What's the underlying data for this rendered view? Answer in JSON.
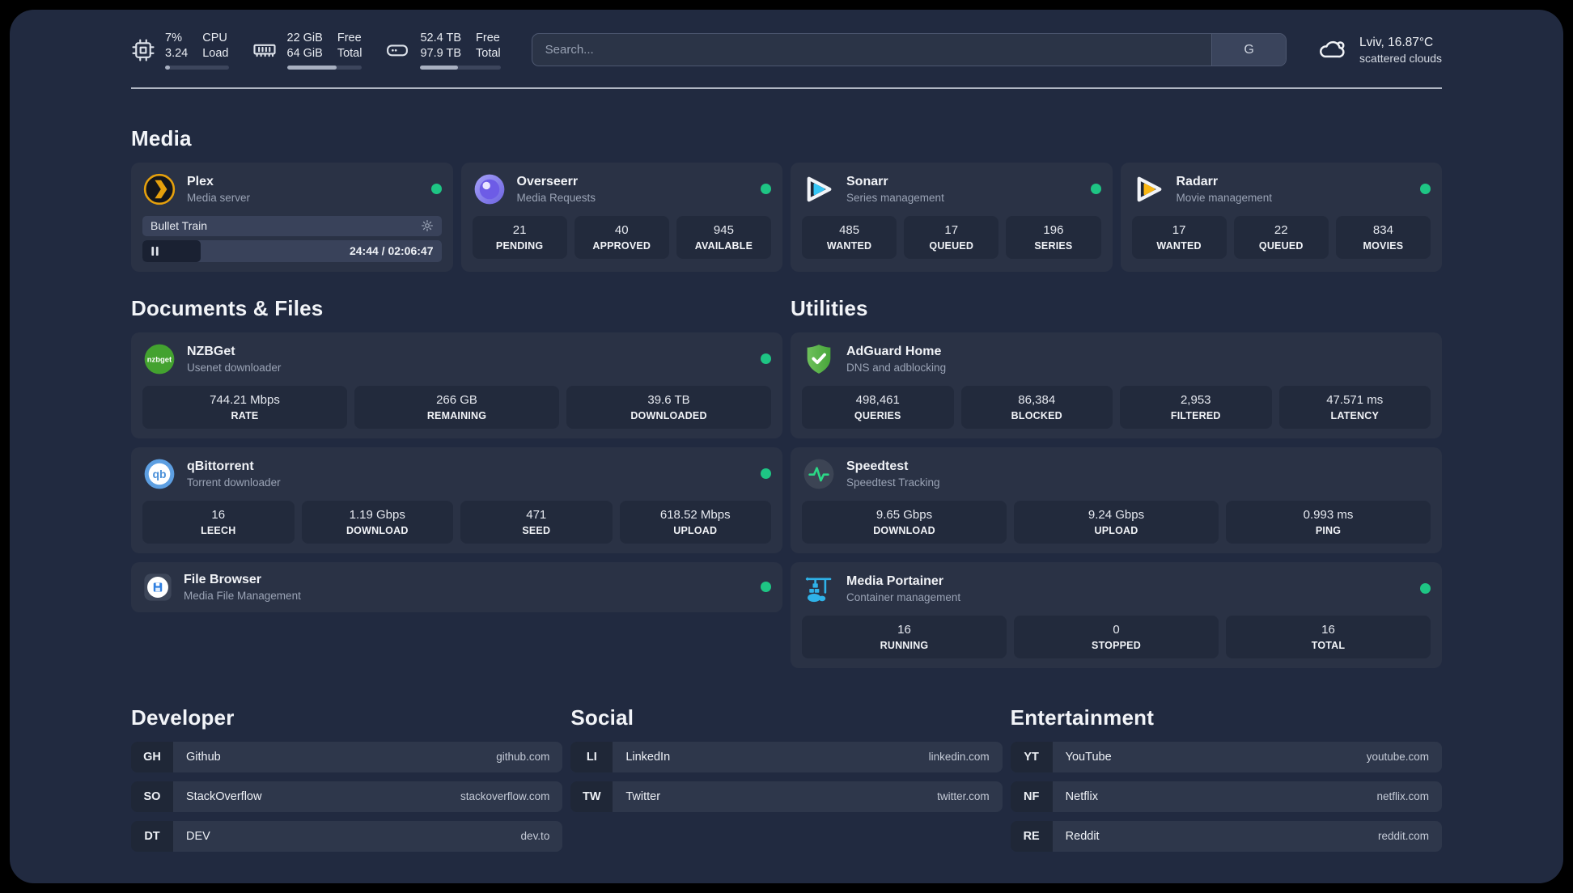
{
  "colors": {
    "panel_bg": "#212A40",
    "card_bg": "#2A3245",
    "tile_bg": "#222A3C",
    "online_dot": "#1EC584",
    "accent_cyan": "#35C5F4",
    "accent_orange": "#E5A00D"
  },
  "header": {
    "stats": [
      {
        "icon": "cpu-icon",
        "values": [
          "7%",
          "3.24"
        ],
        "labels": [
          "CPU",
          "Load"
        ],
        "progress_pct": 8
      },
      {
        "icon": "ram-icon",
        "values": [
          "22 GiB",
          "64 GiB"
        ],
        "labels": [
          "Free",
          "Total"
        ],
        "progress_pct": 66
      },
      {
        "icon": "disk-icon",
        "values": [
          "52.4 TB",
          "97.9 TB"
        ],
        "labels": [
          "Free",
          "Total"
        ],
        "progress_pct": 47
      }
    ],
    "search": {
      "placeholder": "Search...",
      "engine_button": "G"
    },
    "weather": {
      "icon": "cloud-icon",
      "title": "Lviv, 16.87°C",
      "subtitle": "scattered clouds"
    }
  },
  "sections": {
    "media": {
      "title": "Media",
      "cards": [
        {
          "name": "Plex",
          "desc": "Media server",
          "icon": "plex-icon",
          "online": true,
          "player": {
            "title": "Bullet Train",
            "state": "paused",
            "time": "24:44 / 02:06:47",
            "progress_pct": 19.5
          }
        },
        {
          "name": "Overseerr",
          "desc": "Media Requests",
          "icon": "overseerr-icon",
          "online": true,
          "stats": [
            {
              "value": "21",
              "label": "PENDING"
            },
            {
              "value": "40",
              "label": "APPROVED"
            },
            {
              "value": "945",
              "label": "AVAILABLE"
            }
          ]
        },
        {
          "name": "Sonarr",
          "desc": "Series management",
          "icon": "sonarr-icon",
          "online": true,
          "stats": [
            {
              "value": "485",
              "label": "WANTED"
            },
            {
              "value": "17",
              "label": "QUEUED"
            },
            {
              "value": "196",
              "label": "SERIES"
            }
          ]
        },
        {
          "name": "Radarr",
          "desc": "Movie management",
          "icon": "radarr-icon",
          "online": true,
          "stats": [
            {
              "value": "17",
              "label": "WANTED"
            },
            {
              "value": "22",
              "label": "QUEUED"
            },
            {
              "value": "834",
              "label": "MOVIES"
            }
          ]
        }
      ]
    },
    "documents": {
      "title": "Documents & Files",
      "cards": [
        {
          "name": "NZBGet",
          "desc": "Usenet downloader",
          "icon": "nzbget-icon",
          "online": true,
          "stats": [
            {
              "value": "744.21 Mbps",
              "label": "RATE"
            },
            {
              "value": "266 GB",
              "label": "REMAINING"
            },
            {
              "value": "39.6 TB",
              "label": "DOWNLOADED"
            }
          ]
        },
        {
          "name": "qBittorrent",
          "desc": "Torrent downloader",
          "icon": "qbittorrent-icon",
          "online": true,
          "stats": [
            {
              "value": "16",
              "label": "LEECH"
            },
            {
              "value": "1.19 Gbps",
              "label": "DOWNLOAD"
            },
            {
              "value": "471",
              "label": "SEED"
            },
            {
              "value": "618.52 Mbps",
              "label": "UPLOAD"
            }
          ]
        },
        {
          "name": "File Browser",
          "desc": "Media File Management",
          "icon": "filebrowser-icon",
          "online": true,
          "compact": true
        }
      ]
    },
    "utilities": {
      "title": "Utilities",
      "cards": [
        {
          "name": "AdGuard Home",
          "desc": "DNS and adblocking",
          "icon": "adguard-icon",
          "online": false,
          "stats": [
            {
              "value": "498,461",
              "label": "QUERIES"
            },
            {
              "value": "86,384",
              "label": "BLOCKED"
            },
            {
              "value": "2,953",
              "label": "FILTERED"
            },
            {
              "value": "47.571 ms",
              "label": "LATENCY"
            }
          ]
        },
        {
          "name": "Speedtest",
          "desc": "Speedtest Tracking",
          "icon": "speedtest-icon",
          "online": false,
          "stats": [
            {
              "value": "9.65 Gbps",
              "label": "DOWNLOAD"
            },
            {
              "value": "9.24 Gbps",
              "label": "UPLOAD"
            },
            {
              "value": "0.993 ms",
              "label": "PING"
            }
          ]
        },
        {
          "name": "Media Portainer",
          "desc": "Container management",
          "icon": "portainer-icon",
          "online": true,
          "stats": [
            {
              "value": "16",
              "label": "RUNNING"
            },
            {
              "value": "0",
              "label": "STOPPED"
            },
            {
              "value": "16",
              "label": "TOTAL"
            }
          ]
        }
      ]
    },
    "link_groups": [
      {
        "title": "Developer",
        "links": [
          {
            "abbr": "GH",
            "name": "Github",
            "url": "github.com"
          },
          {
            "abbr": "SO",
            "name": "StackOverflow",
            "url": "stackoverflow.com"
          },
          {
            "abbr": "DT",
            "name": "DEV",
            "url": "dev.to"
          }
        ]
      },
      {
        "title": "Social",
        "links": [
          {
            "abbr": "LI",
            "name": "LinkedIn",
            "url": "linkedin.com"
          },
          {
            "abbr": "TW",
            "name": "Twitter",
            "url": "twitter.com"
          }
        ]
      },
      {
        "title": "Entertainment",
        "links": [
          {
            "abbr": "YT",
            "name": "YouTube",
            "url": "youtube.com"
          },
          {
            "abbr": "NF",
            "name": "Netflix",
            "url": "netflix.com"
          },
          {
            "abbr": "RE",
            "name": "Reddit",
            "url": "reddit.com"
          }
        ]
      }
    ]
  }
}
